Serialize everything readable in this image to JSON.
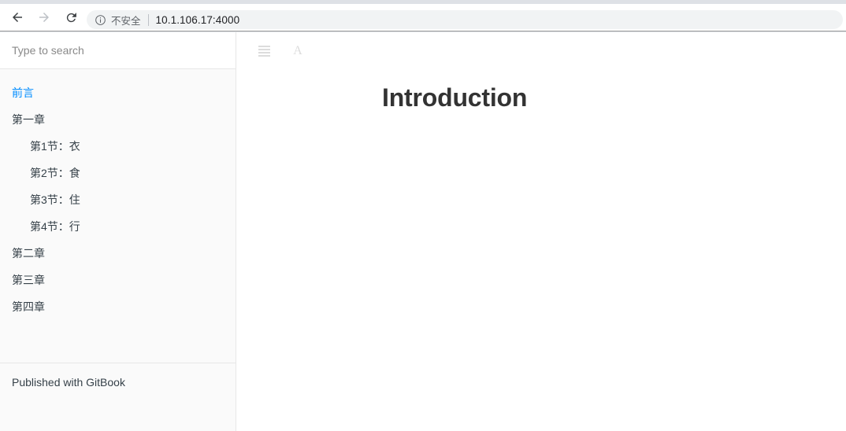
{
  "browser": {
    "back_icon": "back-arrow-icon",
    "forward_icon": "forward-arrow-icon",
    "reload_icon": "reload-icon",
    "security_icon": "info-circle-icon",
    "security_label": "不安全",
    "url": "10.1.106.17:4000"
  },
  "sidebar": {
    "search": {
      "placeholder": "Type to search",
      "value": ""
    },
    "items": [
      {
        "label": "前言",
        "level": 1,
        "active": true
      },
      {
        "label": "第一章",
        "level": 1,
        "active": false
      },
      {
        "label": "第1节：衣",
        "level": 2,
        "active": false
      },
      {
        "label": "第2节：食",
        "level": 2,
        "active": false
      },
      {
        "label": "第3节：住",
        "level": 2,
        "active": false
      },
      {
        "label": "第4节：行",
        "level": 2,
        "active": false
      },
      {
        "label": "第二章",
        "level": 1,
        "active": false
      },
      {
        "label": "第三章",
        "level": 1,
        "active": false
      },
      {
        "label": "第四章",
        "level": 1,
        "active": false
      }
    ],
    "footer": {
      "label": "Published with GitBook"
    }
  },
  "book": {
    "header": {
      "toggle_summary_icon": "hamburger-menu-icon",
      "font_settings_icon": "font-size-A-icon"
    },
    "title": "Introduction"
  },
  "colors": {
    "active_link": "#008cff",
    "text": "#364149",
    "heading": "#333333",
    "sidebar_bg": "#fafafa",
    "border": "#e7e7e7"
  }
}
